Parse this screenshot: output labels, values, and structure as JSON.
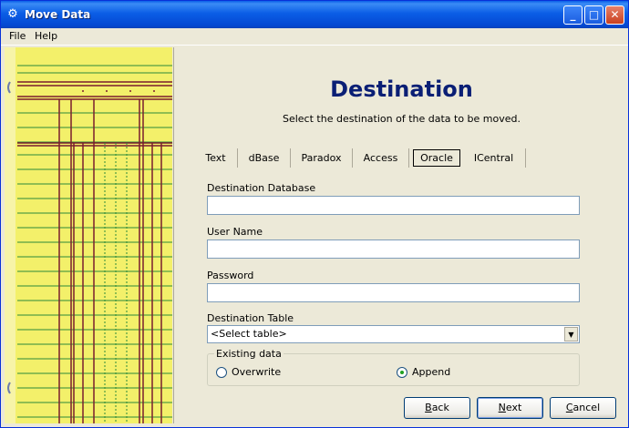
{
  "window": {
    "title": "Move Data",
    "title_icon": "gear-icon",
    "controls": {
      "minimize": "_",
      "maximize": "□",
      "close": "✕"
    }
  },
  "menu": {
    "file": "File",
    "help": "Help"
  },
  "main": {
    "heading": "Destination",
    "subtitle": "Select the destination of the data to be moved."
  },
  "tabs": [
    {
      "label": "Text",
      "selected": false
    },
    {
      "label": "dBase",
      "selected": false
    },
    {
      "label": "Paradox",
      "selected": false
    },
    {
      "label": "Access",
      "selected": false
    },
    {
      "label": "Oracle",
      "selected": true
    },
    {
      "label": "ICentral",
      "selected": false
    }
  ],
  "form": {
    "dest_db_label": "Destination Database",
    "dest_db_value": "",
    "username_label": "User Name",
    "username_value": "",
    "password_label": "Password",
    "password_value": "",
    "table_label": "Destination Table",
    "table_value": "<Select table>",
    "existing_data": {
      "legend": "Existing data",
      "overwrite_label": "Overwrite",
      "append_label": "Append",
      "selected": "Append"
    }
  },
  "buttons": {
    "back_mnemonic": "B",
    "back_rest": "ack",
    "next_mnemonic": "N",
    "next_rest": "ext",
    "cancel_mnemonic": "C",
    "cancel_rest": "ancel"
  },
  "colors": {
    "heading": "#0A1F75",
    "side_panel": "#F3F06A",
    "ledger_lines": "#7A1E2E",
    "ledger_green": "#2E8A3A",
    "radio_dot": "#21A121"
  }
}
